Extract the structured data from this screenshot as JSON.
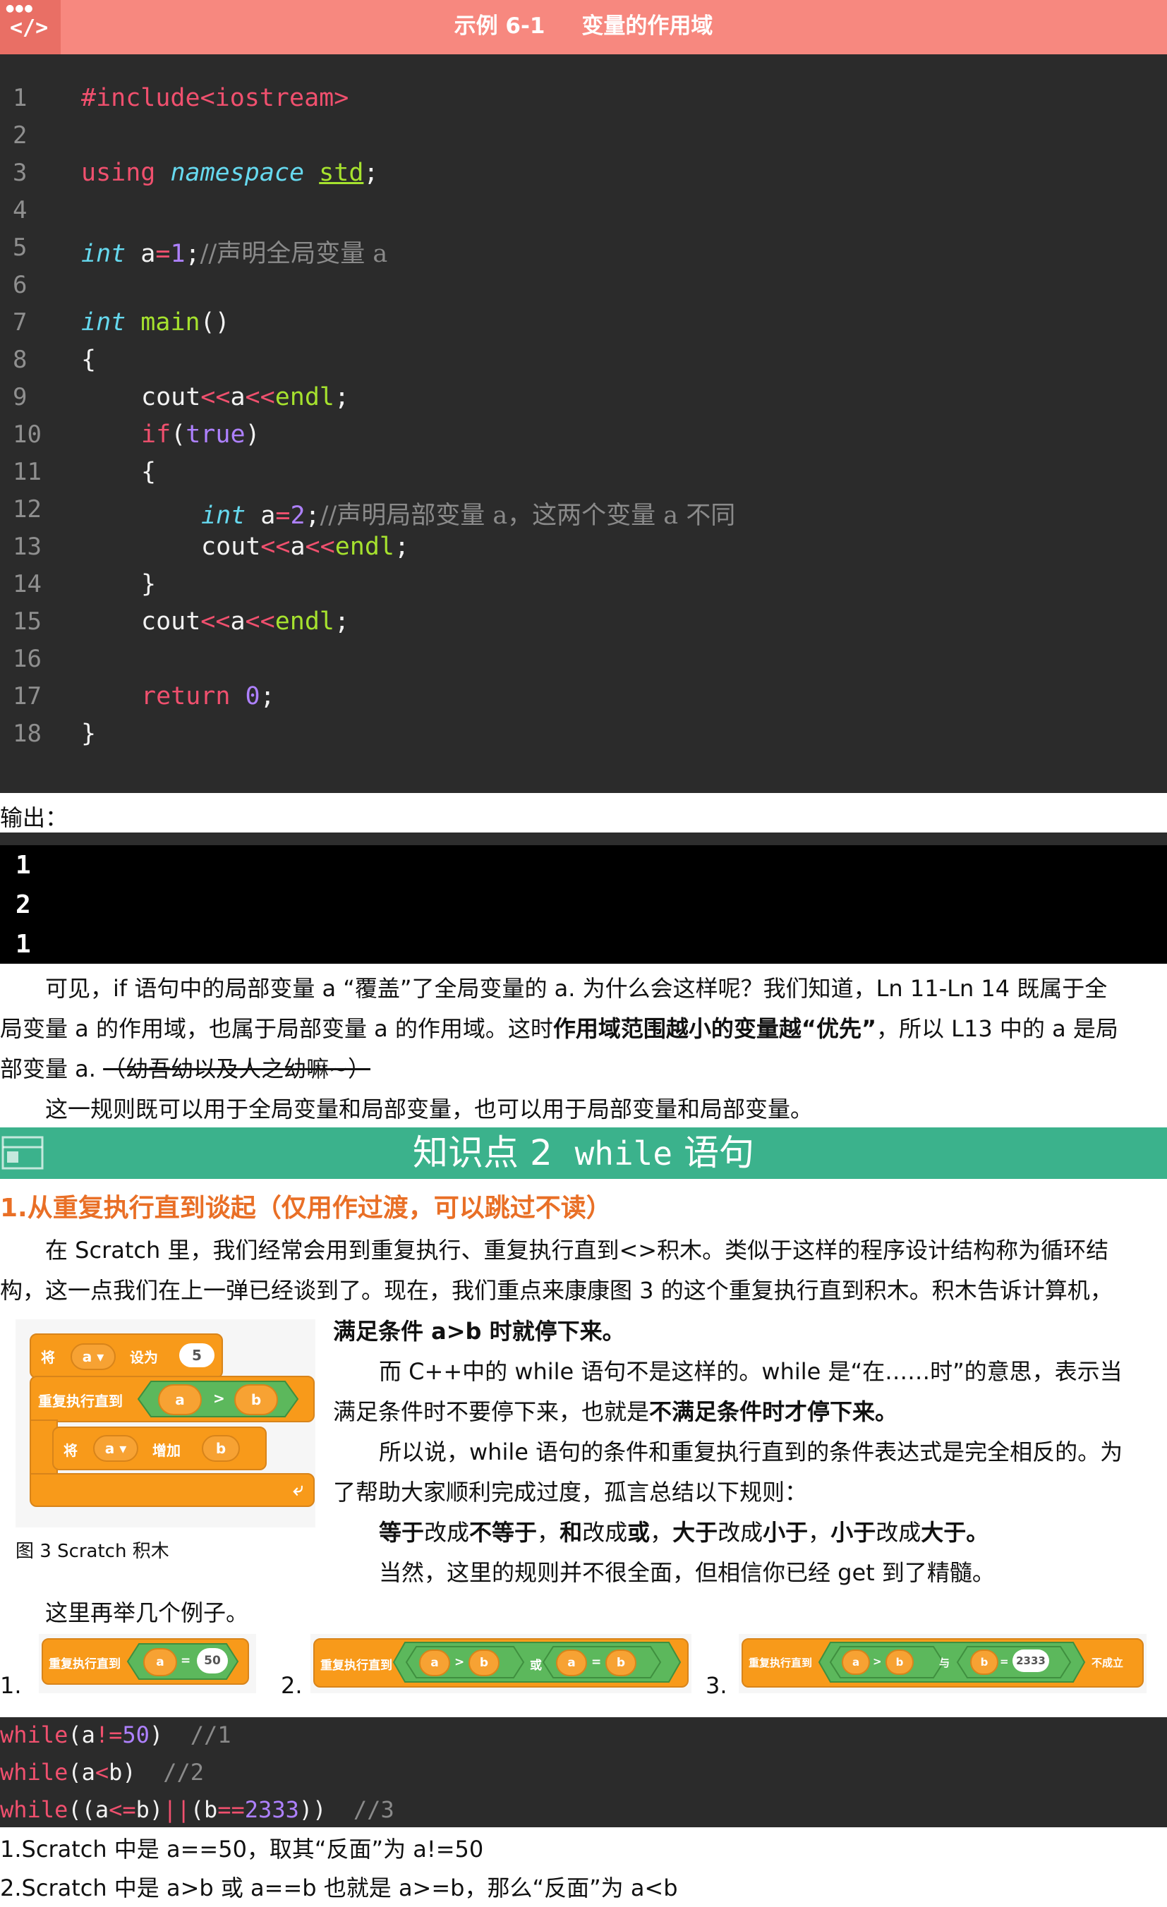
{
  "example": {
    "icon_text": "</>",
    "number": "示例 6-1",
    "title": "变量的作用域"
  },
  "code": [
    {
      "n": "1"
    },
    {
      "n": "2"
    },
    {
      "n": "3"
    },
    {
      "n": "4"
    },
    {
      "n": "5"
    },
    {
      "n": "6"
    },
    {
      "n": "7"
    },
    {
      "n": "8"
    },
    {
      "n": "9"
    },
    {
      "n": "10"
    },
    {
      "n": "11"
    },
    {
      "n": "12"
    },
    {
      "n": "13"
    },
    {
      "n": "14"
    },
    {
      "n": "15"
    },
    {
      "n": "16"
    },
    {
      "n": "17"
    },
    {
      "n": "18"
    }
  ],
  "tokens": {
    "include": "#include<iostream>",
    "using": "using",
    "namespace": "namespace",
    "std": "std",
    "semi": ";",
    "int": "int",
    "a_eq": " a",
    "eq": "=",
    "one": "1",
    "cmt1": "//声明全局变量 a",
    "main": "main",
    "parens": "()",
    "lbrace": "{",
    "rbrace": "}",
    "cout": "cout",
    "shl": "<<",
    "a": "a",
    "endl": "endl",
    "if": "if",
    "lp": "(",
    "rp": ")",
    "true": "true",
    "two": "2",
    "cmt2": "//声明局部变量 a，这两个变量 a 不同",
    "return": "return",
    "zero": "0"
  },
  "output": {
    "label": "输出：",
    "lines": [
      "1",
      "2",
      "1"
    ]
  },
  "paragraphs": {
    "p1_l1": "可见，if 语句中的局部变量 a “覆盖”了全局变量的 a. 为什么会这样呢？我们知道，Ln 11-Ln 14 既属于全",
    "p1_l2a": "局变量 a 的作用域，也属于局部变量 a 的作用域。这时",
    "p1_l2b": "作用域范围越小的变量越“优先”",
    "p1_l2c": "，所以 L13 中的 a 是局",
    "p1_l3a": "部变量 a.",
    "p1_l3b": "（幼吾幼以及人之幼嘛~）",
    "p2": "这一规则既可以用于全局变量和局部变量，也可以用于局部变量和局部变量。"
  },
  "knowledge": {
    "prefix": "知识点 2",
    "keyword": "while",
    "suffix": "语句"
  },
  "section": {
    "heading": "1.从重复执行直到谈起（仅用作过渡，可以跳过不读）",
    "s1": "在 Scratch 里，我们经常会用到重复执行、重复执行直到<>积木。类似于这样的程序设计结构称为循环结",
    "s2": "构，这一点我们在上一弹已经谈到了。现在，我们重点来康康图 3 的这个重复执行直到积木。积木告诉计算机，",
    "r1": "满足条件 a>b 时就停下来。",
    "r2": "而 C++中的 while 语句不是这样的。while 是“在……时”的意思，表示当",
    "r3a": "满足条件时不要停下来，也就是",
    "r3b": "不满足条件时才停下来。",
    "r4": "所以说，while 语句的条件和重复执行直到的条件表达式是完全相反的。为",
    "r5": "了帮助大家顺利完成过度，孤言总结以下规则：",
    "rule_a": "等于",
    "rule_b": "改成",
    "rule_c": "不等于",
    "rule_d": "，",
    "rule_e": "和",
    "rule_f": "或",
    "rule_g": "大于",
    "rule_h": "小于",
    "r7": "当然，这里的规则并不很全面，但相信你已经 get 到了精髓。",
    "more": "这里再举几个例子。"
  },
  "figure": {
    "caption": "图 3  Scratch 积木",
    "set": "将",
    "var": "a ▾",
    "set_to": "设为",
    "val5": "5",
    "repeat": "重复执行直到",
    "a": "a",
    "gt": ">",
    "b": "b",
    "change": "增加",
    "loop_icon": "⤶"
  },
  "examples": {
    "n1": "1.",
    "n2": "2.",
    "n3": "3.",
    "repeat": "重复执行直到",
    "a": "a",
    "b": "b",
    "eq": "=",
    "gt": ">",
    "v50": "50",
    "v2333": "2333",
    "or": "或",
    "and": "与",
    "not": "不成立"
  },
  "code2": {
    "while": "while",
    "l1a": "(a",
    "l1b": "!=",
    "l1c": "50",
    "l1d": ")",
    "l1e": "  //1",
    "l2a": "(a",
    "l2b": "<",
    "l2c": "b)",
    "l2e": "  //2",
    "l3a": "((a",
    "l3b": "<=",
    "l3c": "b)",
    "l3d": "||",
    "l3e": "(b",
    "l3f": "==",
    "l3g": "2333",
    "l3h": "))",
    "l3i": "  //3"
  },
  "tail": {
    "t1": "1.Scratch 中是 a==50，取其“反面”为 a!=50",
    "t2": "2.Scratch 中是 a>b 或 a==b 也就是 a>=b，那么“反面”为 a<b"
  }
}
